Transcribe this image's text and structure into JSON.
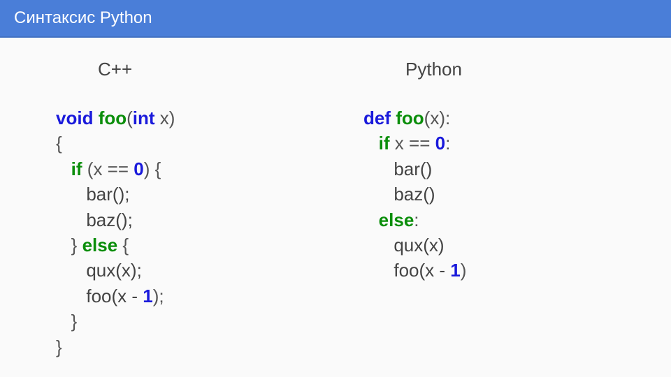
{
  "header": {
    "title": "Синтаксис Python"
  },
  "columns": {
    "left": {
      "title": "C++"
    },
    "right": {
      "title": "Python"
    }
  },
  "cpp": {
    "l1_void": "void",
    "l1_foo": "foo",
    "l1_open": "(",
    "l1_int": "int",
    "l1_x": " x)",
    "l2": "{",
    "l3_if": "if",
    "l3_pre": " (x == ",
    "l3_zero": "0",
    "l3_post": ") {",
    "l4": "bar();",
    "l5": "baz();",
    "l6_pre": "} ",
    "l6_else": "else",
    "l6_post": " {",
    "l7": "qux(x);",
    "l8_pre": "foo(x - ",
    "l8_one": "1",
    "l8_post": ");",
    "l9": "}",
    "l10": "}"
  },
  "py": {
    "l1_def": "def",
    "l1_foo": "foo",
    "l1_rest": "(x):",
    "l2_if": "if",
    "l2_pre": " x == ",
    "l2_zero": "0",
    "l2_post": ":",
    "l3": "bar()",
    "l4": "baz()",
    "l5_else": "else",
    "l5_post": ":",
    "l6": "qux(x)",
    "l7_pre": "foo(x - ",
    "l7_one": "1",
    "l7_post": ")"
  }
}
